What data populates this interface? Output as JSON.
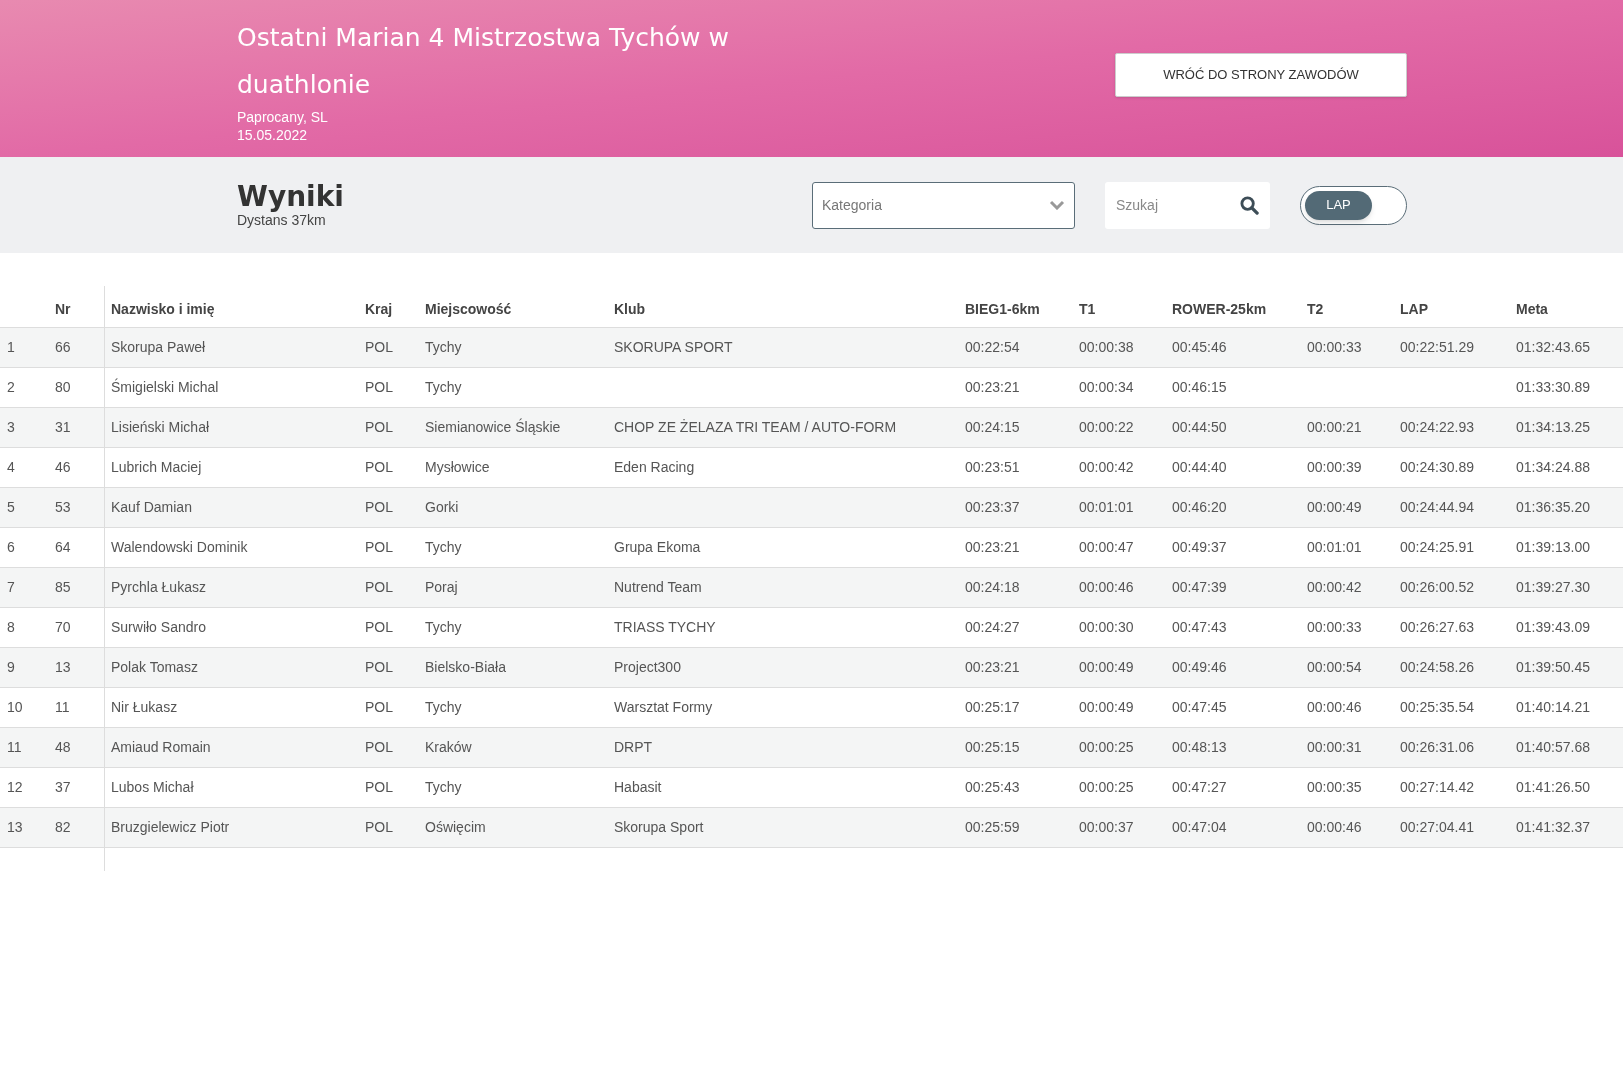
{
  "header": {
    "title": "Ostatni Marian 4 Mistrzostwa Tychów w duathlonie",
    "location": "Paprocany, SL",
    "date": "15.05.2022",
    "back_button": "WRÓĆ DO STRONY ZAWODÓW"
  },
  "toolbar": {
    "title": "Wyniki",
    "subtitle": "Dystans 37km",
    "category": {
      "placeholder": "Kategoria"
    },
    "search": {
      "placeholder": "Szukaj"
    },
    "toggle": {
      "label": "LAP",
      "on": true
    }
  },
  "table": {
    "columns": [
      "",
      "Nr",
      "Nazwisko i imię",
      "Kraj",
      "Miejscowość",
      "Klub",
      "BIEG1-6km",
      "T1",
      "ROWER-25km",
      "T2",
      "LAP",
      "Meta"
    ],
    "rows": [
      [
        "1",
        "66",
        "Skorupa Paweł",
        "POL",
        "Tychy",
        "SKORUPA SPORT",
        "00:22:54",
        "00:00:38",
        "00:45:46",
        "00:00:33",
        "00:22:51.29",
        "01:32:43.65"
      ],
      [
        "2",
        "80",
        "Śmigielski Michal",
        "POL",
        "Tychy",
        "",
        "00:23:21",
        "00:00:34",
        "00:46:15",
        "",
        "",
        "01:33:30.89"
      ],
      [
        "3",
        "31",
        "Lisieński Michał",
        "POL",
        "Siemianowice Śląskie",
        "CHOP ZE ŻELAZA TRI TEAM / AUTO-FORM",
        "00:24:15",
        "00:00:22",
        "00:44:50",
        "00:00:21",
        "00:24:22.93",
        "01:34:13.25"
      ],
      [
        "4",
        "46",
        "Lubrich Maciej",
        "POL",
        "Mysłowice",
        "Eden Racing",
        "00:23:51",
        "00:00:42",
        "00:44:40",
        "00:00:39",
        "00:24:30.89",
        "01:34:24.88"
      ],
      [
        "5",
        "53",
        "Kauf Damian",
        "POL",
        "Gorki",
        "",
        "00:23:37",
        "00:01:01",
        "00:46:20",
        "00:00:49",
        "00:24:44.94",
        "01:36:35.20"
      ],
      [
        "6",
        "64",
        "Walendowski Dominik",
        "POL",
        "Tychy",
        "Grupa Ekoma",
        "00:23:21",
        "00:00:47",
        "00:49:37",
        "00:01:01",
        "00:24:25.91",
        "01:39:13.00"
      ],
      [
        "7",
        "85",
        "Pyrchla Łukasz",
        "POL",
        "Poraj",
        "Nutrend Team",
        "00:24:18",
        "00:00:46",
        "00:47:39",
        "00:00:42",
        "00:26:00.52",
        "01:39:27.30"
      ],
      [
        "8",
        "70",
        "Surwiło Sandro",
        "POL",
        "Tychy",
        "TRIASS TYCHY",
        "00:24:27",
        "00:00:30",
        "00:47:43",
        "00:00:33",
        "00:26:27.63",
        "01:39:43.09"
      ],
      [
        "9",
        "13",
        "Polak Tomasz",
        "POL",
        "Bielsko-Biała",
        "Project300",
        "00:23:21",
        "00:00:49",
        "00:49:46",
        "00:00:54",
        "00:24:58.26",
        "01:39:50.45"
      ],
      [
        "10",
        "11",
        "Nir Łukasz",
        "POL",
        "Tychy",
        "Warsztat Formy",
        "00:25:17",
        "00:00:49",
        "00:47:45",
        "00:00:46",
        "00:25:35.54",
        "01:40:14.21"
      ],
      [
        "11",
        "48",
        "Amiaud Romain",
        "POL",
        "Kraków",
        "DRPT",
        "00:25:15",
        "00:00:25",
        "00:48:13",
        "00:00:31",
        "00:26:31.06",
        "01:40:57.68"
      ],
      [
        "12",
        "37",
        "Lubos Michał",
        "POL",
        "Tychy",
        "Habasit",
        "00:25:43",
        "00:00:25",
        "00:47:27",
        "00:00:35",
        "00:27:14.42",
        "01:41:26.50"
      ],
      [
        "13",
        "82",
        "Bruzgielewicz Piotr",
        "POL",
        "Oświęcim",
        "Skorupa Sport",
        "00:25:59",
        "00:00:37",
        "00:47:04",
        "00:00:46",
        "00:27:04.41",
        "01:41:32.37"
      ]
    ]
  }
}
